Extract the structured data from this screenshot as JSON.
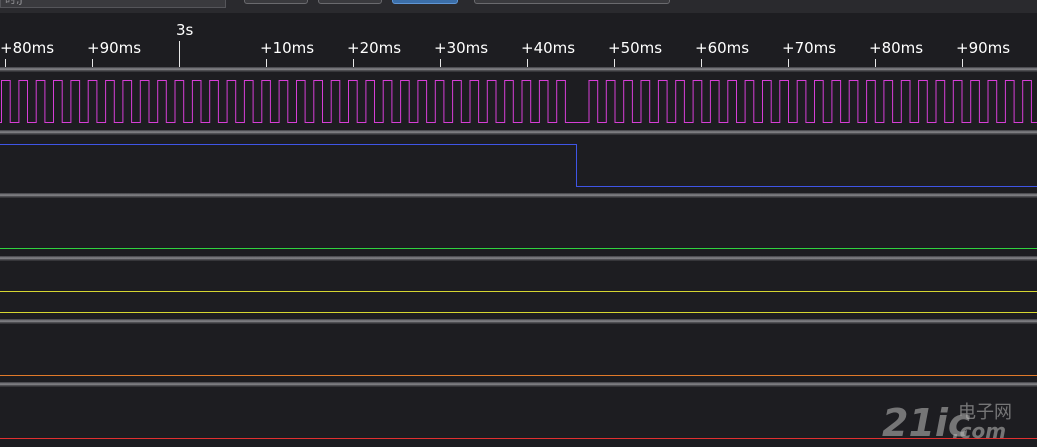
{
  "toolbar": {
    "field_text": "时,J",
    "buttons": [
      {
        "name": "toolbar-button-1"
      },
      {
        "name": "toolbar-button-2"
      },
      {
        "name": "toolbar-button-3",
        "active": true
      },
      {
        "name": "toolbar-button-4"
      }
    ]
  },
  "ruler": {
    "major": {
      "label": "3s"
    },
    "ticks": [
      "+80ms",
      "+90ms",
      "+10ms",
      "+20ms",
      "+30ms",
      "+40ms",
      "+50ms",
      "+60ms",
      "+70ms",
      "+80ms",
      "+90ms"
    ]
  },
  "channels": [
    {
      "name": "channel-0-clock",
      "color": "#d63ed6",
      "type": "clock"
    },
    {
      "name": "channel-1",
      "color": "#3f55e6",
      "type": "step"
    },
    {
      "name": "channel-2",
      "color": "#2fd23f",
      "type": "flat"
    },
    {
      "name": "channel-3",
      "color": "#d6d631",
      "type": "flat-double"
    },
    {
      "name": "channel-4",
      "color": "#e07a2a",
      "type": "flat"
    },
    {
      "name": "channel-5",
      "color": "#e03030",
      "type": "flat"
    }
  ],
  "watermark": {
    "brand": "21ic",
    "chinese": "电子网",
    "domain": ".com"
  }
}
